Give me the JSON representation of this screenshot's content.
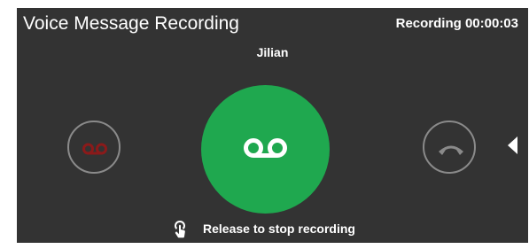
{
  "header": {
    "title": "Voice Message Recording",
    "timer": "Recording 00:00:03"
  },
  "contact": {
    "name": "Jilian"
  },
  "controls": {
    "left_icon": "voicemail-icon",
    "center_icon": "voicemail-icon",
    "right_icon": "phone-hangup-icon",
    "panel_toggle_icon": "triangle-left-icon"
  },
  "hint": {
    "icon": "touch-hand-icon",
    "text": "Release to stop recording"
  },
  "colors": {
    "background": "#333333",
    "record_button": "#1fa84f",
    "voicemail_icon_left": "#8b1a1a",
    "side_button_border": "#8a8a8a"
  }
}
